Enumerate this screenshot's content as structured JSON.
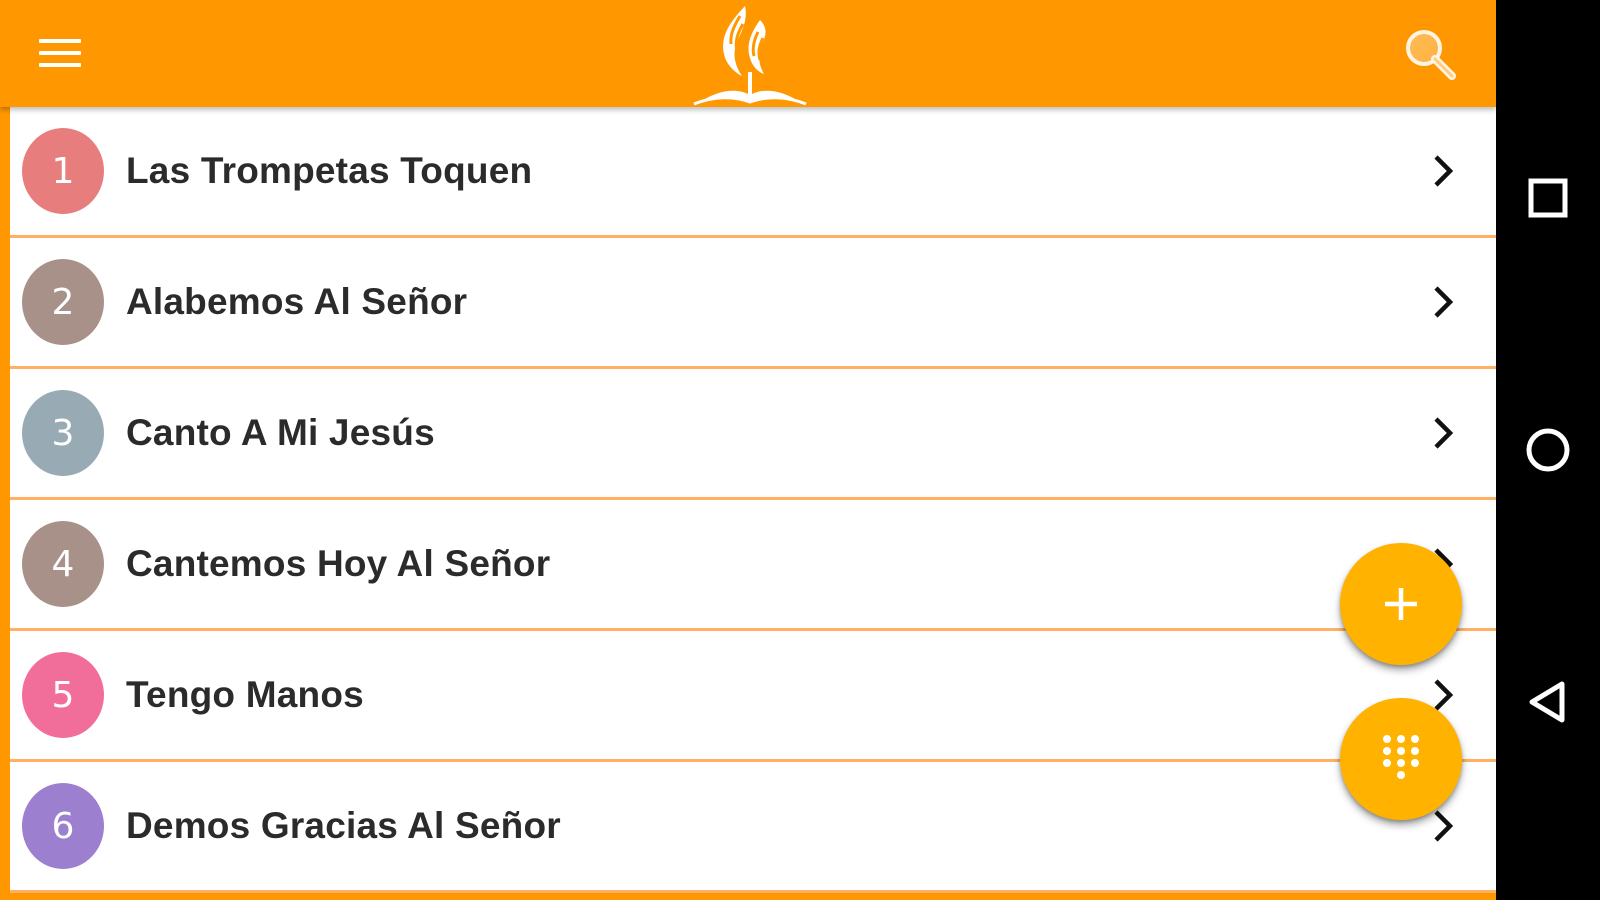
{
  "appbar": {
    "menu_icon": "hamburger-menu-icon",
    "logo_icon": "adventist-flame-bible-logo",
    "search_icon": "search-magnifier-icon",
    "color": "#ff9800"
  },
  "hymns": [
    {
      "number": "1",
      "title": "Las Trompetas Toquen",
      "color": "#e57373"
    },
    {
      "number": "2",
      "title": "Alabemos Al Señor",
      "color": "#a1887f"
    },
    {
      "number": "3",
      "title": "Canto A Mi Jesús",
      "color": "#90a4ae"
    },
    {
      "number": "4",
      "title": "Cantemos Hoy Al Señor",
      "color": "#a1887f"
    },
    {
      "number": "5",
      "title": "Tengo Manos",
      "color": "#f06292"
    },
    {
      "number": "6",
      "title": "Demos Gracias Al Señor",
      "color": "#9575cd"
    }
  ],
  "fab": {
    "add_icon": "plus-icon",
    "dialpad_icon": "dialpad-icon",
    "color": "#ffb300"
  },
  "system_nav": {
    "recents_icon": "square-recents-icon",
    "home_icon": "circle-home-icon",
    "back_icon": "triangle-back-icon"
  }
}
